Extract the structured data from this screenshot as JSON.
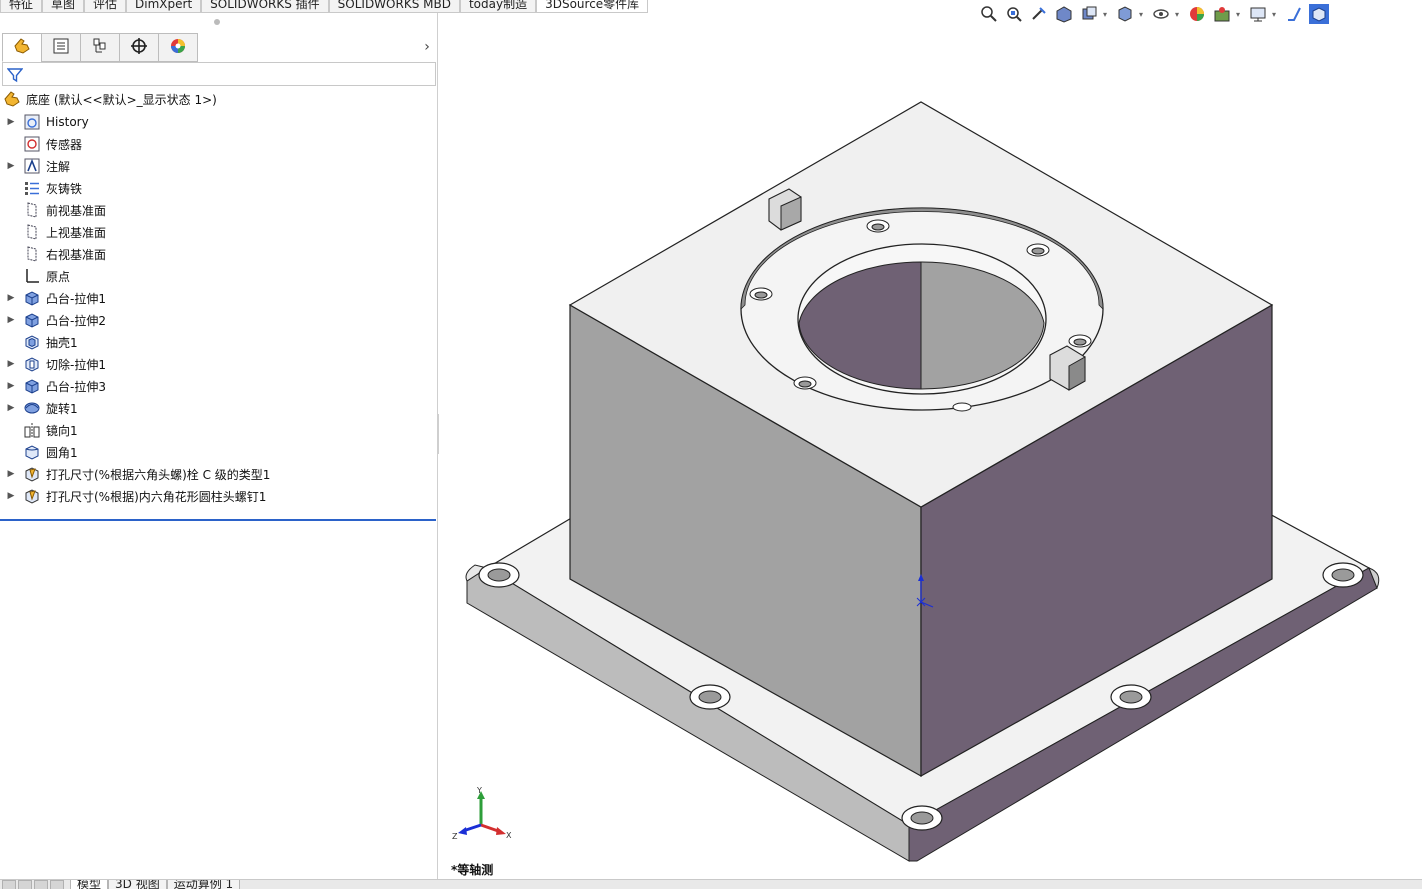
{
  "top_tabs": [
    {
      "label": "特征"
    },
    {
      "label": "草图"
    },
    {
      "label": "评估"
    },
    {
      "label": "DimXpert"
    },
    {
      "label": "SOLIDWORKS 插件"
    },
    {
      "label": "SOLIDWORKS MBD"
    },
    {
      "label": "today制造"
    },
    {
      "label": "3DSource零件库"
    }
  ],
  "feature_manager": {
    "tabs": [
      {
        "icon": "feature-manager-icon"
      },
      {
        "icon": "property-manager-icon"
      },
      {
        "icon": "configuration-manager-icon"
      },
      {
        "icon": "dimxpert-manager-icon"
      },
      {
        "icon": "display-manager-icon"
      }
    ],
    "expand_glyph": "›",
    "root": "底座 (默认<<默认>_显示状态 1>)",
    "items": [
      {
        "label": "History",
        "expandable": true,
        "icon": "history-icon"
      },
      {
        "label": "传感器",
        "expandable": false,
        "icon": "sensor-icon"
      },
      {
        "label": "注解",
        "expandable": true,
        "icon": "annotation-icon"
      },
      {
        "label": "灰铸铁",
        "expandable": false,
        "icon": "material-icon"
      },
      {
        "label": "前视基准面",
        "expandable": false,
        "icon": "plane-icon"
      },
      {
        "label": "上视基准面",
        "expandable": false,
        "icon": "plane-icon"
      },
      {
        "label": "右视基准面",
        "expandable": false,
        "icon": "plane-icon"
      },
      {
        "label": "原点",
        "expandable": false,
        "icon": "origin-icon"
      },
      {
        "label": "凸台-拉伸1",
        "expandable": true,
        "icon": "boss-extrude-icon"
      },
      {
        "label": "凸台-拉伸2",
        "expandable": true,
        "icon": "boss-extrude-icon"
      },
      {
        "label": "抽壳1",
        "expandable": false,
        "icon": "shell-icon"
      },
      {
        "label": "切除-拉伸1",
        "expandable": true,
        "icon": "cut-extrude-icon"
      },
      {
        "label": "凸台-拉伸3",
        "expandable": true,
        "icon": "boss-extrude-icon"
      },
      {
        "label": "旋转1",
        "expandable": true,
        "icon": "revolve-icon"
      },
      {
        "label": "镜向1",
        "expandable": false,
        "icon": "mirror-icon"
      },
      {
        "label": "圆角1",
        "expandable": false,
        "icon": "fillet-icon"
      },
      {
        "label": "打孔尺寸(%根据六角头螺)栓 C 级的类型1",
        "expandable": true,
        "icon": "hole-wizard-icon"
      },
      {
        "label": "打孔尺寸(%根据)内六角花形圆柱头螺钉1",
        "expandable": true,
        "icon": "hole-wizard-icon"
      }
    ]
  },
  "viewport": {
    "view_label": "*等轴测",
    "triad": {
      "x": "X",
      "y": "Y",
      "z": "Z"
    },
    "heads_up_icons": [
      "zoom-to-fit-icon",
      "zoom-to-area-icon",
      "previous-view-icon",
      "section-view-icon",
      "view-orientation-icon",
      "display-style-icon",
      "hide-show-icon",
      "edit-appearance-icon",
      "apply-scene-icon",
      "view-settings-icon",
      "rotate-icon",
      "isometric-cube-icon"
    ]
  },
  "bottom_tabs": [
    {
      "label": "模型"
    },
    {
      "label": "3D 视图"
    },
    {
      "label": "运动算例 1"
    }
  ],
  "colors": {
    "accent": "#2b62c9",
    "face_top": "#f0f0f0",
    "face_left": "#a2a2a2",
    "face_right": "#6f6174"
  }
}
